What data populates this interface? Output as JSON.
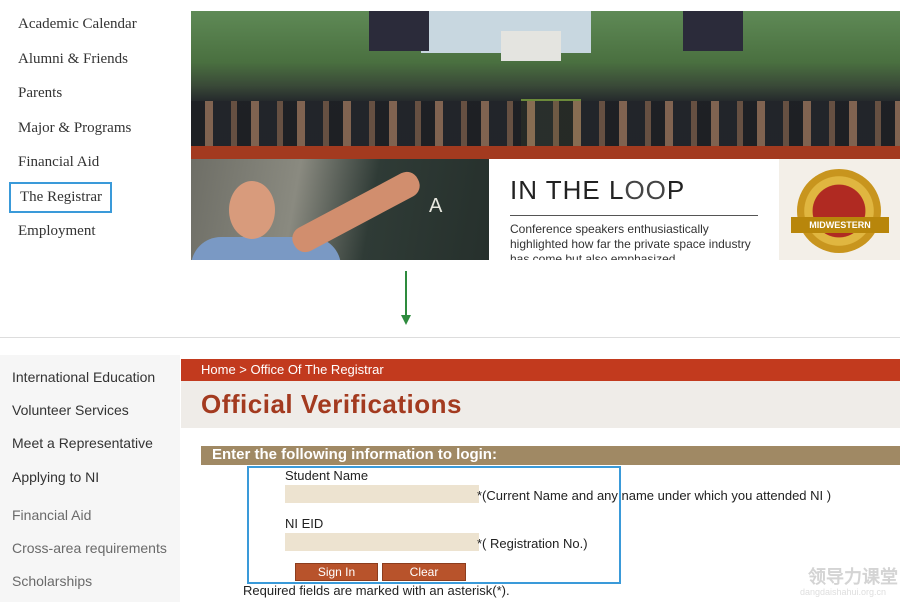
{
  "top_sidebar": {
    "items": [
      {
        "label": "Academic Calendar"
      },
      {
        "label": "Alumni & Friends"
      },
      {
        "label": "Parents"
      },
      {
        "label": "Major & Programs"
      },
      {
        "label": "Financial Aid"
      },
      {
        "label": "The Registrar",
        "highlighted": true
      },
      {
        "label": "Employment"
      }
    ]
  },
  "banner": {
    "loop_title_pre": "IN THE L",
    "loop_title_oo": "OO",
    "loop_title_post": "P",
    "loop_text": "Conference speakers enthusiastically highlighted how far the private space industry has come but also emphasized",
    "badge_ribbon": "MIDWESTERN",
    "chalk_text": "A"
  },
  "lower_sidebar": {
    "items": [
      {
        "label": "International Education"
      },
      {
        "label": "Volunteer Services"
      },
      {
        "label": "Meet a Representative"
      },
      {
        "label": "Applying to NI"
      },
      {
        "label": "Financial Aid"
      },
      {
        "label": "Cross-area requirements"
      },
      {
        "label": "Scholarships"
      }
    ]
  },
  "breadcrumb": "Home > Office Of The Registrar",
  "page_title": "Official Verifications",
  "form": {
    "heading": "Enter the following information to login:",
    "student_name_label": "Student Name",
    "student_name_value": "",
    "student_name_hint": "*(Current Name and any name under which you attended NI )",
    "eid_label": "NI EID",
    "eid_value": "",
    "eid_hint": "*( Registration No.)",
    "sign_in_label": "Sign In",
    "clear_label": "Clear",
    "required_note": "Required fields are marked with an asterisk(*)."
  },
  "watermark": {
    "text": "领导力课堂",
    "sub": "dangdaishahui.org.cn"
  },
  "colors": {
    "accent_red": "#c23a1e",
    "title_red": "#a33a1f",
    "form_bar": "#a08964",
    "highlight_blue": "#3a9ad9",
    "arrow_green": "#2e8b3e"
  }
}
